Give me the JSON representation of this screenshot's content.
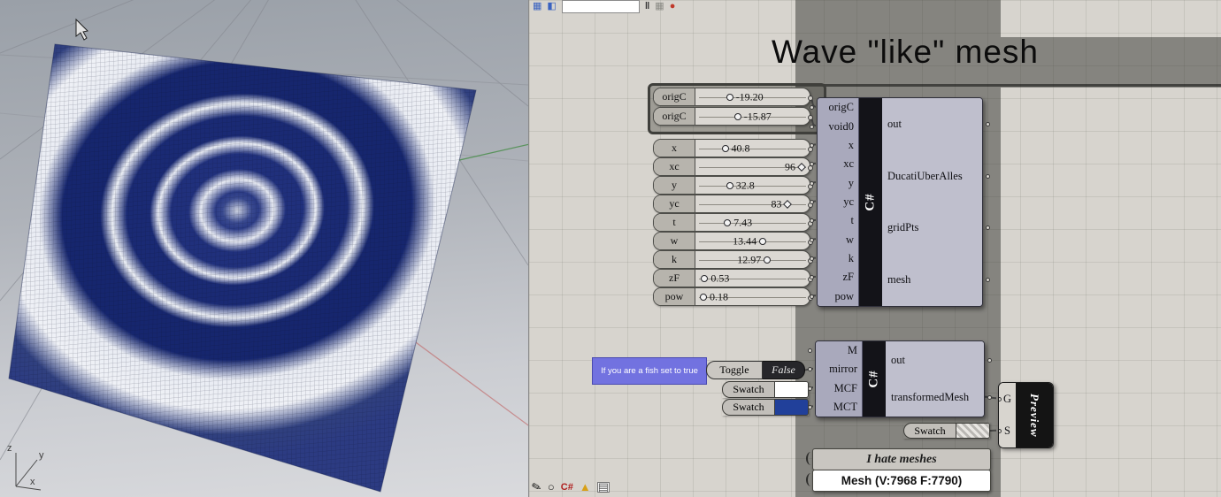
{
  "viewport": {
    "axis_labels": {
      "x": "x",
      "y": "y",
      "z": "z"
    }
  },
  "toolbar": {
    "combo_value": "",
    "icons": [
      {
        "name": "blue-grid-icon",
        "glyph": "▦"
      },
      {
        "name": "blue-panel-icon",
        "glyph": "◧"
      },
      {
        "name": "pause-icon",
        "glyph": "‖"
      },
      {
        "name": "snap-grid-icon",
        "glyph": "▦"
      },
      {
        "name": "record-icon",
        "glyph": "●"
      }
    ]
  },
  "canvas": {
    "title": "Wave \"like\" mesh",
    "sliders": [
      {
        "label": "origC",
        "value": "-19.20",
        "pct": 30,
        "side": "after",
        "shape": "circle"
      },
      {
        "label": "origC",
        "value": "-15.87",
        "pct": 37,
        "side": "after",
        "shape": "circle"
      },
      {
        "label": "x",
        "value": "40.8",
        "pct": 26,
        "side": "after",
        "shape": "circle"
      },
      {
        "label": "xc",
        "value": "96",
        "pct": 93,
        "side": "before",
        "shape": "diamond"
      },
      {
        "label": "y",
        "value": "32.8",
        "pct": 30,
        "side": "after",
        "shape": "circle"
      },
      {
        "label": "yc",
        "value": "83",
        "pct": 81,
        "side": "before",
        "shape": "diamond"
      },
      {
        "label": "t",
        "value": "7.43",
        "pct": 28,
        "side": "after",
        "shape": "circle"
      },
      {
        "label": "w",
        "value": "13.44",
        "pct": 59,
        "side": "before",
        "shape": "circle"
      },
      {
        "label": "k",
        "value": "12.97",
        "pct": 63,
        "side": "before",
        "shape": "circle"
      },
      {
        "label": "zF",
        "value": "0.53",
        "pct": 8,
        "side": "after",
        "shape": "circle"
      },
      {
        "label": "pow",
        "value": "0.18",
        "pct": 7,
        "side": "after",
        "shape": "circle"
      }
    ],
    "script_component": {
      "label": "C#",
      "inputs": [
        "origC",
        "void0",
        "x",
        "xc",
        "y",
        "yc",
        "t",
        "w",
        "k",
        "zF",
        "pow"
      ],
      "outputs": [
        "out",
        "DucatiUberAlles",
        "gridPts",
        "mesh"
      ]
    },
    "mirror_component": {
      "label": "C#",
      "inputs": [
        "M",
        "mirror",
        "MCF",
        "MCT"
      ],
      "outputs": [
        "out",
        "transformedMesh"
      ]
    },
    "toggle": {
      "note": "If you are a fish set to true",
      "label": "Toggle",
      "value": "False"
    },
    "swatches": [
      {
        "label": "Swatch",
        "color": "#ffffff"
      },
      {
        "label": "Swatch",
        "color": "#21409a"
      },
      {
        "label": "Swatch",
        "pattern": "hatch"
      }
    ],
    "preview": {
      "label": "Preview",
      "inputs": [
        "G",
        "S"
      ]
    },
    "panels": {
      "note": "I hate meshes",
      "mesh_info": "Mesh (V:7968  F:7790)"
    },
    "status_icons": [
      {
        "name": "sketch-icon",
        "glyph": "✎"
      },
      {
        "name": "circle-icon",
        "glyph": "○"
      },
      {
        "name": "csharp-icon",
        "glyph": "C#"
      },
      {
        "name": "script-icon",
        "glyph": "▲"
      },
      {
        "name": "panel-icon",
        "glyph": "▤"
      }
    ]
  }
}
